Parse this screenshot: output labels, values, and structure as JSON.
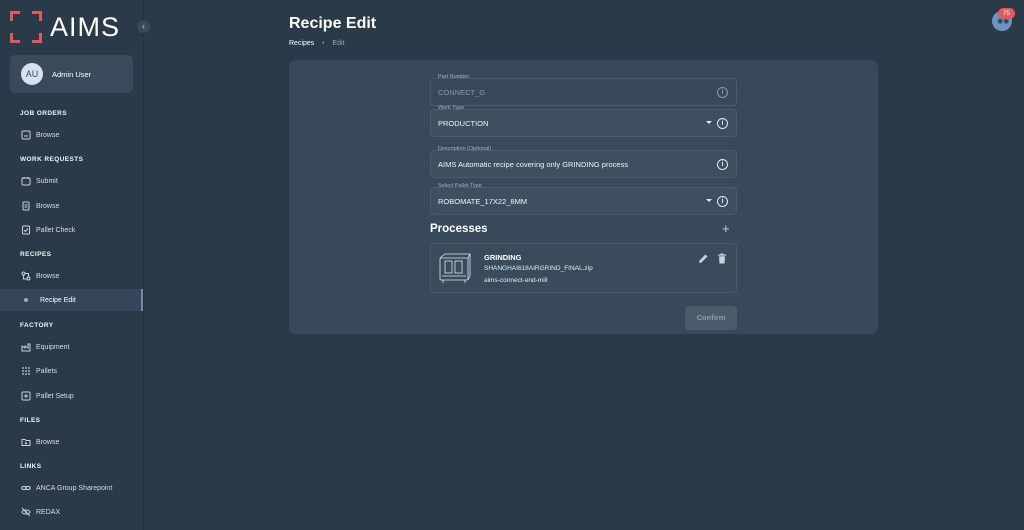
{
  "app": {
    "name": "AIMS"
  },
  "user": {
    "initials": "AU",
    "name": "Admin User"
  },
  "sidebar": {
    "sections": [
      {
        "label": "JOB ORDERS",
        "items": [
          {
            "label": "Browse",
            "icon": "browse-icon"
          }
        ]
      },
      {
        "label": "WORK REQUESTS",
        "items": [
          {
            "label": "Submit",
            "icon": "submit-icon"
          },
          {
            "label": "Browse",
            "icon": "clipboard-icon"
          },
          {
            "label": "Pallet Check",
            "icon": "checklist-icon"
          }
        ]
      },
      {
        "label": "RECIPES",
        "items": [
          {
            "label": "Browse",
            "icon": "recipe-icon"
          },
          {
            "label": "Recipe Edit",
            "icon": "dot",
            "active": true
          }
        ]
      },
      {
        "label": "FACTORY",
        "items": [
          {
            "label": "Equipment",
            "icon": "factory-icon"
          },
          {
            "label": "Pallets",
            "icon": "grid-icon"
          },
          {
            "label": "Pallet Setup",
            "icon": "plus-box-icon"
          }
        ]
      },
      {
        "label": "FILES",
        "items": [
          {
            "label": "Browse",
            "icon": "folder-icon"
          }
        ]
      },
      {
        "label": "LINKS",
        "items": [
          {
            "label": "ANCA Group Sharepoint",
            "icon": "link-icon"
          },
          {
            "label": "REDAX",
            "icon": "redax-icon"
          }
        ]
      }
    ]
  },
  "header": {
    "title": "Recipe Edit",
    "breadcrumb": {
      "root": "Recipes",
      "current": "Edit"
    },
    "notifications": {
      "count": "75"
    }
  },
  "form": {
    "part_number": {
      "label": "Part Number",
      "value": "CONNECT_G"
    },
    "work_type": {
      "label": "Work Type",
      "value": "PRODUCTION"
    },
    "description": {
      "label": "Description (Optional)",
      "value": "AIMS Automatic recipe covering only GRINDING process"
    },
    "pallet_type": {
      "label": "Select Pallet Type",
      "value": "ROBOMATE_17X22_8MM"
    }
  },
  "processes": {
    "title": "Processes",
    "items": [
      {
        "name": "GRINDING",
        "file": "SHANGHAI618AIRGRIND_FINAL.zip",
        "tool": "aims-connect-end-mill"
      }
    ]
  },
  "actions": {
    "confirm_label": "Confirm"
  },
  "colors": {
    "background": "#2b3a48",
    "card": "#384a59",
    "accent": "#e0595c",
    "badge": "#e25a5a"
  }
}
